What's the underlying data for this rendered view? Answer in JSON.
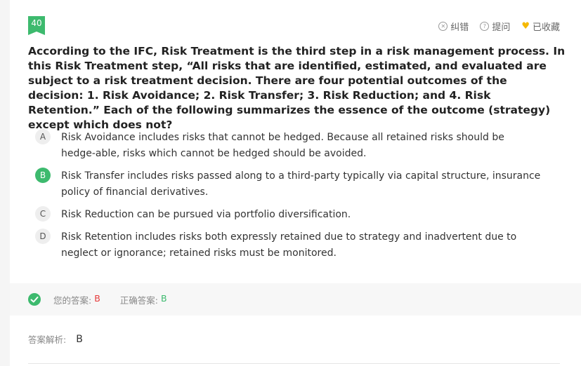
{
  "question": {
    "number": "40",
    "text": "According to the IFC, Risk Treatment is the third step in a risk management process. In this Risk Treatment step, “All risks that are identified, estimated, and evaluated are subject to a risk treatment decision. There are four potential outcomes of the decision: 1. Risk Avoidance; 2. Risk Transfer; 3. Risk Reduction; and 4. Risk Retention.” Each of the following summarizes the essence of the outcome (strategy) except which does not?"
  },
  "toolbar": {
    "report_label": "纠错",
    "ask_label": "提问",
    "favorite_label": "已收藏"
  },
  "options": [
    {
      "letter": "A",
      "text": "Risk Avoidance includes risks that cannot be hedged. Because all retained risks should be hedge-able, risks which cannot be hedged should be avoided."
    },
    {
      "letter": "B",
      "text": "Risk Transfer includes risks passed along to a third-party typically via capital structure, insurance policy of financial derivatives."
    },
    {
      "letter": "C",
      "text": "Risk Reduction can be pursued via portfolio diversification."
    },
    {
      "letter": "D",
      "text": "Risk Retention includes risks both expressly retained due to strategy and inadvertent due to neglect or ignorance; retained risks must be monitored."
    }
  ],
  "result": {
    "your_answer_label": "您的答案:",
    "your_answer": "B",
    "correct_answer_label": "正确答案:",
    "correct_answer": "B"
  },
  "analysis": {
    "label": "答案解析:",
    "value": "B"
  },
  "colors": {
    "accent": "#3dba6e",
    "wrong": "#e63b3b",
    "favorite": "#f5b800"
  }
}
